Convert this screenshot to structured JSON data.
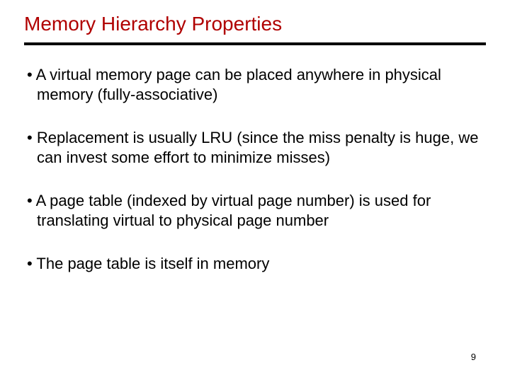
{
  "title": "Memory Hierarchy Properties",
  "bullets": [
    "A virtual memory page can be placed anywhere in physical memory (fully-associative)",
    "Replacement is usually LRU (since the miss penalty is huge, we can invest some effort to minimize misses)",
    "A page table (indexed by virtual page number) is used for translating virtual to physical page number",
    "The page table is itself in memory"
  ],
  "page_number": "9"
}
